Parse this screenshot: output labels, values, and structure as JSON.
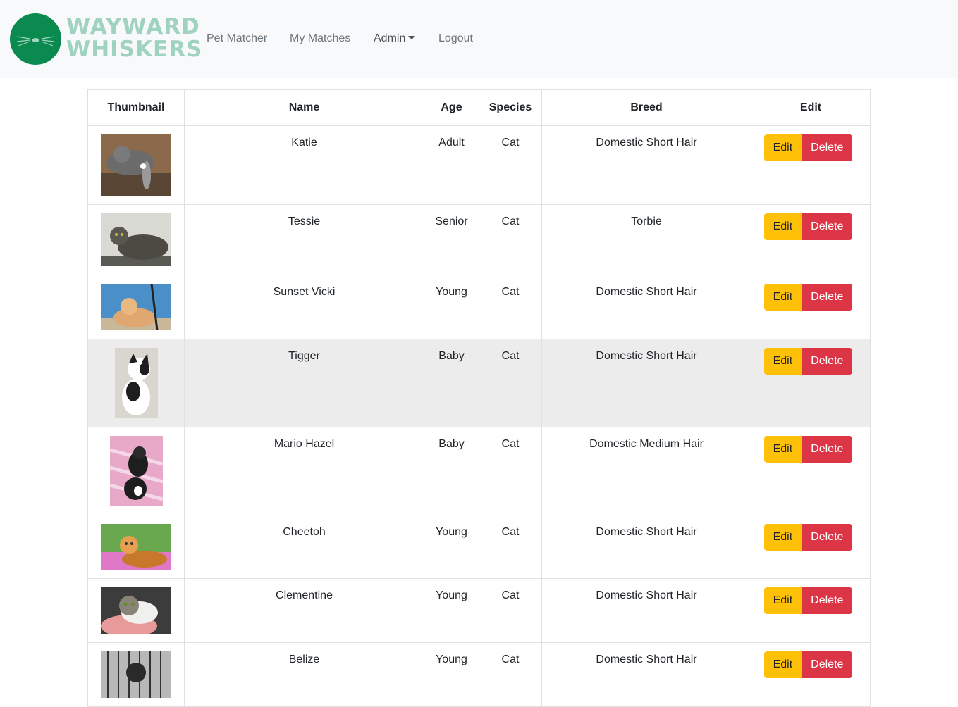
{
  "brand": {
    "line1": "WAYWARD",
    "line2": "WHISKERS"
  },
  "nav": {
    "pet_matcher": "Pet Matcher",
    "my_matches": "My Matches",
    "admin": "Admin",
    "logout": "Logout"
  },
  "table": {
    "headers": {
      "thumbnail": "Thumbnail",
      "name": "Name",
      "age": "Age",
      "species": "Species",
      "breed": "Breed",
      "edit": "Edit"
    },
    "edit_label": "Edit",
    "delete_label": "Delete",
    "rows": [
      {
        "name": "Katie",
        "age": "Adult",
        "species": "Cat",
        "breed": "Domestic Short Hair"
      },
      {
        "name": "Tessie",
        "age": "Senior",
        "species": "Cat",
        "breed": "Torbie"
      },
      {
        "name": "Sunset Vicki",
        "age": "Young",
        "species": "Cat",
        "breed": "Domestic Short Hair"
      },
      {
        "name": "Tigger",
        "age": "Baby",
        "species": "Cat",
        "breed": "Domestic Short Hair"
      },
      {
        "name": "Mario Hazel",
        "age": "Baby",
        "species": "Cat",
        "breed": "Domestic Medium Hair"
      },
      {
        "name": "Cheetoh",
        "age": "Young",
        "species": "Cat",
        "breed": "Domestic Short Hair"
      },
      {
        "name": "Clementine",
        "age": "Young",
        "species": "Cat",
        "breed": "Domestic Short Hair"
      },
      {
        "name": "Belize",
        "age": "Young",
        "species": "Cat",
        "breed": "Domestic Short Hair"
      }
    ]
  },
  "colors": {
    "logo": "#0a8a4e",
    "edit": "#ffc107",
    "delete": "#dc3545",
    "hover_row": "#ececec"
  }
}
